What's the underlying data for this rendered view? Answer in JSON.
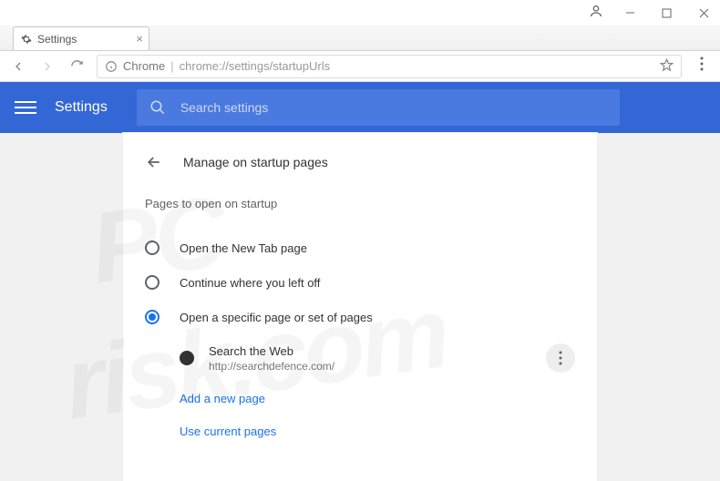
{
  "window": {
    "tab_title": "Settings"
  },
  "addressbar": {
    "scheme": "Chrome",
    "path": "chrome://settings/startupUrls"
  },
  "bluebar": {
    "title": "Settings",
    "search_placeholder": "Search settings"
  },
  "card": {
    "title": "Manage on startup pages",
    "section_label": "Pages to open on startup",
    "options": {
      "new_tab": "Open the New Tab page",
      "continue": "Continue where you left off",
      "specific": "Open a specific page or set of pages"
    },
    "selected": "specific",
    "pages": [
      {
        "title": "Search the Web",
        "url": "http://searchdefence.com/"
      }
    ],
    "links": {
      "add": "Add a new page",
      "use_current": "Use current pages"
    }
  }
}
